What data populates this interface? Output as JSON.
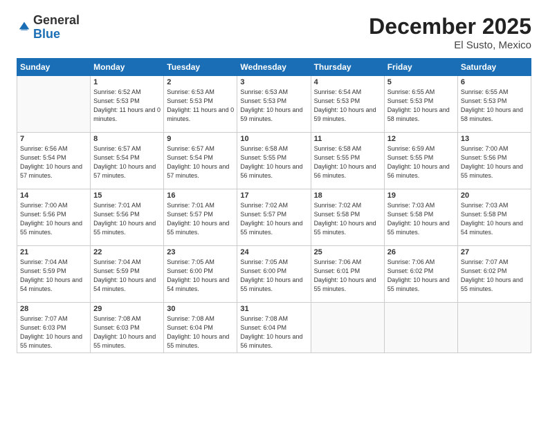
{
  "logo": {
    "general": "General",
    "blue": "Blue"
  },
  "title": "December 2025",
  "subtitle": "El Susto, Mexico",
  "days_header": [
    "Sunday",
    "Monday",
    "Tuesday",
    "Wednesday",
    "Thursday",
    "Friday",
    "Saturday"
  ],
  "weeks": [
    [
      {
        "num": "",
        "sunrise": "",
        "sunset": "",
        "daylight": ""
      },
      {
        "num": "1",
        "sunrise": "Sunrise: 6:52 AM",
        "sunset": "Sunset: 5:53 PM",
        "daylight": "Daylight: 11 hours and 0 minutes."
      },
      {
        "num": "2",
        "sunrise": "Sunrise: 6:53 AM",
        "sunset": "Sunset: 5:53 PM",
        "daylight": "Daylight: 11 hours and 0 minutes."
      },
      {
        "num": "3",
        "sunrise": "Sunrise: 6:53 AM",
        "sunset": "Sunset: 5:53 PM",
        "daylight": "Daylight: 10 hours and 59 minutes."
      },
      {
        "num": "4",
        "sunrise": "Sunrise: 6:54 AM",
        "sunset": "Sunset: 5:53 PM",
        "daylight": "Daylight: 10 hours and 59 minutes."
      },
      {
        "num": "5",
        "sunrise": "Sunrise: 6:55 AM",
        "sunset": "Sunset: 5:53 PM",
        "daylight": "Daylight: 10 hours and 58 minutes."
      },
      {
        "num": "6",
        "sunrise": "Sunrise: 6:55 AM",
        "sunset": "Sunset: 5:53 PM",
        "daylight": "Daylight: 10 hours and 58 minutes."
      }
    ],
    [
      {
        "num": "7",
        "sunrise": "Sunrise: 6:56 AM",
        "sunset": "Sunset: 5:54 PM",
        "daylight": "Daylight: 10 hours and 57 minutes."
      },
      {
        "num": "8",
        "sunrise": "Sunrise: 6:57 AM",
        "sunset": "Sunset: 5:54 PM",
        "daylight": "Daylight: 10 hours and 57 minutes."
      },
      {
        "num": "9",
        "sunrise": "Sunrise: 6:57 AM",
        "sunset": "Sunset: 5:54 PM",
        "daylight": "Daylight: 10 hours and 57 minutes."
      },
      {
        "num": "10",
        "sunrise": "Sunrise: 6:58 AM",
        "sunset": "Sunset: 5:55 PM",
        "daylight": "Daylight: 10 hours and 56 minutes."
      },
      {
        "num": "11",
        "sunrise": "Sunrise: 6:58 AM",
        "sunset": "Sunset: 5:55 PM",
        "daylight": "Daylight: 10 hours and 56 minutes."
      },
      {
        "num": "12",
        "sunrise": "Sunrise: 6:59 AM",
        "sunset": "Sunset: 5:55 PM",
        "daylight": "Daylight: 10 hours and 56 minutes."
      },
      {
        "num": "13",
        "sunrise": "Sunrise: 7:00 AM",
        "sunset": "Sunset: 5:56 PM",
        "daylight": "Daylight: 10 hours and 55 minutes."
      }
    ],
    [
      {
        "num": "14",
        "sunrise": "Sunrise: 7:00 AM",
        "sunset": "Sunset: 5:56 PM",
        "daylight": "Daylight: 10 hours and 55 minutes."
      },
      {
        "num": "15",
        "sunrise": "Sunrise: 7:01 AM",
        "sunset": "Sunset: 5:56 PM",
        "daylight": "Daylight: 10 hours and 55 minutes."
      },
      {
        "num": "16",
        "sunrise": "Sunrise: 7:01 AM",
        "sunset": "Sunset: 5:57 PM",
        "daylight": "Daylight: 10 hours and 55 minutes."
      },
      {
        "num": "17",
        "sunrise": "Sunrise: 7:02 AM",
        "sunset": "Sunset: 5:57 PM",
        "daylight": "Daylight: 10 hours and 55 minutes."
      },
      {
        "num": "18",
        "sunrise": "Sunrise: 7:02 AM",
        "sunset": "Sunset: 5:58 PM",
        "daylight": "Daylight: 10 hours and 55 minutes."
      },
      {
        "num": "19",
        "sunrise": "Sunrise: 7:03 AM",
        "sunset": "Sunset: 5:58 PM",
        "daylight": "Daylight: 10 hours and 55 minutes."
      },
      {
        "num": "20",
        "sunrise": "Sunrise: 7:03 AM",
        "sunset": "Sunset: 5:58 PM",
        "daylight": "Daylight: 10 hours and 54 minutes."
      }
    ],
    [
      {
        "num": "21",
        "sunrise": "Sunrise: 7:04 AM",
        "sunset": "Sunset: 5:59 PM",
        "daylight": "Daylight: 10 hours and 54 minutes."
      },
      {
        "num": "22",
        "sunrise": "Sunrise: 7:04 AM",
        "sunset": "Sunset: 5:59 PM",
        "daylight": "Daylight: 10 hours and 54 minutes."
      },
      {
        "num": "23",
        "sunrise": "Sunrise: 7:05 AM",
        "sunset": "Sunset: 6:00 PM",
        "daylight": "Daylight: 10 hours and 54 minutes."
      },
      {
        "num": "24",
        "sunrise": "Sunrise: 7:05 AM",
        "sunset": "Sunset: 6:00 PM",
        "daylight": "Daylight: 10 hours and 55 minutes."
      },
      {
        "num": "25",
        "sunrise": "Sunrise: 7:06 AM",
        "sunset": "Sunset: 6:01 PM",
        "daylight": "Daylight: 10 hours and 55 minutes."
      },
      {
        "num": "26",
        "sunrise": "Sunrise: 7:06 AM",
        "sunset": "Sunset: 6:02 PM",
        "daylight": "Daylight: 10 hours and 55 minutes."
      },
      {
        "num": "27",
        "sunrise": "Sunrise: 7:07 AM",
        "sunset": "Sunset: 6:02 PM",
        "daylight": "Daylight: 10 hours and 55 minutes."
      }
    ],
    [
      {
        "num": "28",
        "sunrise": "Sunrise: 7:07 AM",
        "sunset": "Sunset: 6:03 PM",
        "daylight": "Daylight: 10 hours and 55 minutes."
      },
      {
        "num": "29",
        "sunrise": "Sunrise: 7:08 AM",
        "sunset": "Sunset: 6:03 PM",
        "daylight": "Daylight: 10 hours and 55 minutes."
      },
      {
        "num": "30",
        "sunrise": "Sunrise: 7:08 AM",
        "sunset": "Sunset: 6:04 PM",
        "daylight": "Daylight: 10 hours and 55 minutes."
      },
      {
        "num": "31",
        "sunrise": "Sunrise: 7:08 AM",
        "sunset": "Sunset: 6:04 PM",
        "daylight": "Daylight: 10 hours and 56 minutes."
      },
      {
        "num": "",
        "sunrise": "",
        "sunset": "",
        "daylight": ""
      },
      {
        "num": "",
        "sunrise": "",
        "sunset": "",
        "daylight": ""
      },
      {
        "num": "",
        "sunrise": "",
        "sunset": "",
        "daylight": ""
      }
    ]
  ]
}
